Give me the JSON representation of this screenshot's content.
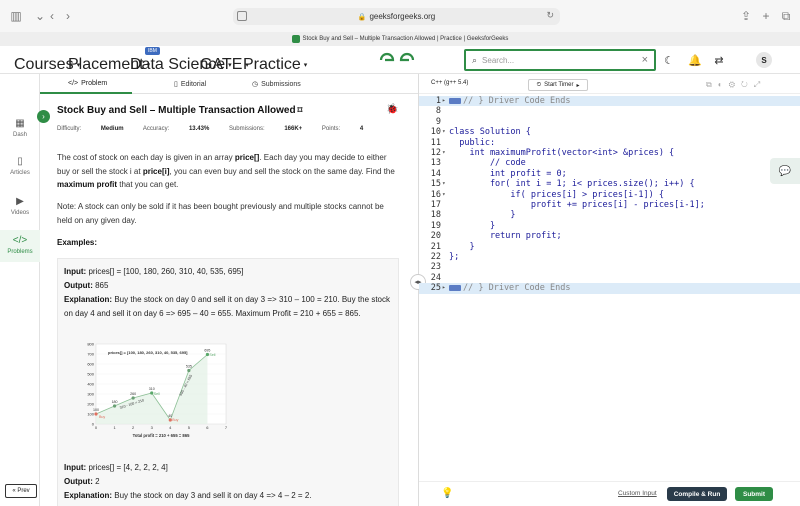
{
  "browser": {
    "url": "geeksforgeeks.org",
    "tab_title": "Stock Buy and Sell – Multiple Transaction Allowed | Practice | GeeksforGeeks"
  },
  "nav": {
    "items": [
      "Courses",
      "Placement",
      "Data Science",
      "GATE",
      "Practice"
    ],
    "ibm_badge": "IBM",
    "search_placeholder": "Search...",
    "avatar_initial": "S"
  },
  "sidebar": {
    "items": [
      "Dash",
      "Articles",
      "Videos",
      "Problems"
    ],
    "prev_label": "« Prev"
  },
  "problem_tabs": [
    "Problem",
    "Editorial",
    "Submissions"
  ],
  "problem": {
    "title": "Stock Buy and Sell – Multiple Transaction Allowed",
    "difficulty_label": "Difficulty:",
    "difficulty": "Medium",
    "accuracy_label": "Accuracy:",
    "accuracy": "13.43%",
    "submissions_label": "Submissions:",
    "submissions": "166K+",
    "points_label": "Points:",
    "points": "4",
    "p1_a": "The cost of stock on each day is given in an array ",
    "p1_b": "price[]",
    "p1_c": ". Each day you may decide to either buy or sell the stock i at ",
    "p1_d": "price[i]",
    "p1_e": ", you can even buy and sell the stock on the same day. Find the ",
    "p1_f": "maximum profit",
    "p1_g": " that you can get.",
    "note": "Note: A stock can only be sold if it has been bought previously and multiple stocks cannot be held on any given day.",
    "examples_heading": "Examples:",
    "ex1_input_label": "Input:",
    "ex1_input": "prices[] = [100, 180, 260, 310, 40, 535, 695]",
    "ex1_output_label": "Output:",
    "ex1_output": "865",
    "ex1_expl_label": "Explanation:",
    "ex1_expl": "Buy the stock on day 0 and sell it on day 3 => 310 – 100 = 210. Buy the stock on day 4 and sell it on day 6 => 695 – 40 = 655. Maximum Profit = 210 + 655 = 865.",
    "ex2_input_label": "Input:",
    "ex2_input": "prices[] = [4, 2, 2, 2, 4]",
    "ex2_output_label": "Output:",
    "ex2_output": "2",
    "ex2_expl_label": "Explanation:",
    "ex2_expl": "Buy the stock on day 3 and sell it on day 4 => 4 – 2 = 2."
  },
  "chart_data": {
    "type": "line",
    "title": "prices[] = [100, 180, 260, 310, 40, 535, 695]",
    "xlabel": "Total profit = 210 + 655 = 865",
    "x": [
      0,
      1,
      2,
      3,
      4,
      5,
      6
    ],
    "series": [
      {
        "values": [
          100,
          180,
          260,
          310,
          40,
          535,
          695
        ]
      }
    ],
    "xlim": [
      0,
      7
    ],
    "ylim": [
      0,
      800
    ],
    "xticks": [
      "0",
      "1",
      "2",
      "3",
      "4",
      "5",
      "6",
      "7"
    ],
    "yticks": [
      "0",
      "100",
      "200",
      "300",
      "400",
      "500",
      "600",
      "700",
      "800"
    ],
    "point_labels": [
      "100",
      "180",
      "260",
      "310",
      "40",
      "535",
      "695"
    ],
    "annotations": [
      "Buy",
      "Sell",
      "Buy",
      "Sell",
      "310 - 100 = 210",
      "695 - 40 = 655"
    ],
    "colors": {
      "line": "#8cbf95",
      "buy": "#e07060",
      "sell": "#5aa86a"
    }
  },
  "editor": {
    "language": "C++ (g++ 5.4)",
    "timer_label": "Start Timer",
    "lines": [
      {
        "n": "1",
        "fold": "▸",
        "text": "// } Driver Code Ends",
        "hl": true,
        "marker": true
      },
      {
        "n": "8",
        "fold": "",
        "text": "",
        "hl": false
      },
      {
        "n": "9",
        "fold": "",
        "text": "",
        "hl": false
      },
      {
        "n": "10",
        "fold": "▾",
        "text": "class Solution {",
        "hl": false
      },
      {
        "n": "11",
        "fold": "",
        "text": "  public:",
        "hl": false
      },
      {
        "n": "12",
        "fold": "▾",
        "text": "    int maximumProfit(vector<int> &prices) {",
        "hl": false
      },
      {
        "n": "13",
        "fold": "",
        "text": "        // code",
        "hl": false
      },
      {
        "n": "14",
        "fold": "",
        "text": "        int profit = 0;",
        "hl": false
      },
      {
        "n": "15",
        "fold": "▾",
        "text": "        for( int i = 1; i< prices.size(); i++) {",
        "hl": false
      },
      {
        "n": "16",
        "fold": "▾",
        "text": "            if( prices[i] > prices[i-1]) {",
        "hl": false
      },
      {
        "n": "17",
        "fold": "",
        "text": "                profit += prices[i] - prices[i-1];",
        "hl": false
      },
      {
        "n": "18",
        "fold": "",
        "text": "            }",
        "hl": false
      },
      {
        "n": "19",
        "fold": "",
        "text": "        }",
        "hl": false
      },
      {
        "n": "20",
        "fold": "",
        "text": "        return profit;",
        "hl": false
      },
      {
        "n": "21",
        "fold": "",
        "text": "    }",
        "hl": false
      },
      {
        "n": "22",
        "fold": "",
        "text": "};",
        "hl": false
      },
      {
        "n": "23",
        "fold": "",
        "text": "",
        "hl": false
      },
      {
        "n": "24",
        "fold": "",
        "text": "",
        "hl": false
      },
      {
        "n": "25",
        "fold": "▸",
        "text": "// } Driver Code Ends",
        "hl": true,
        "marker": true
      }
    ],
    "custom_input": "Custom Input",
    "compile_label": "Compile & Run",
    "submit_label": "Submit"
  }
}
